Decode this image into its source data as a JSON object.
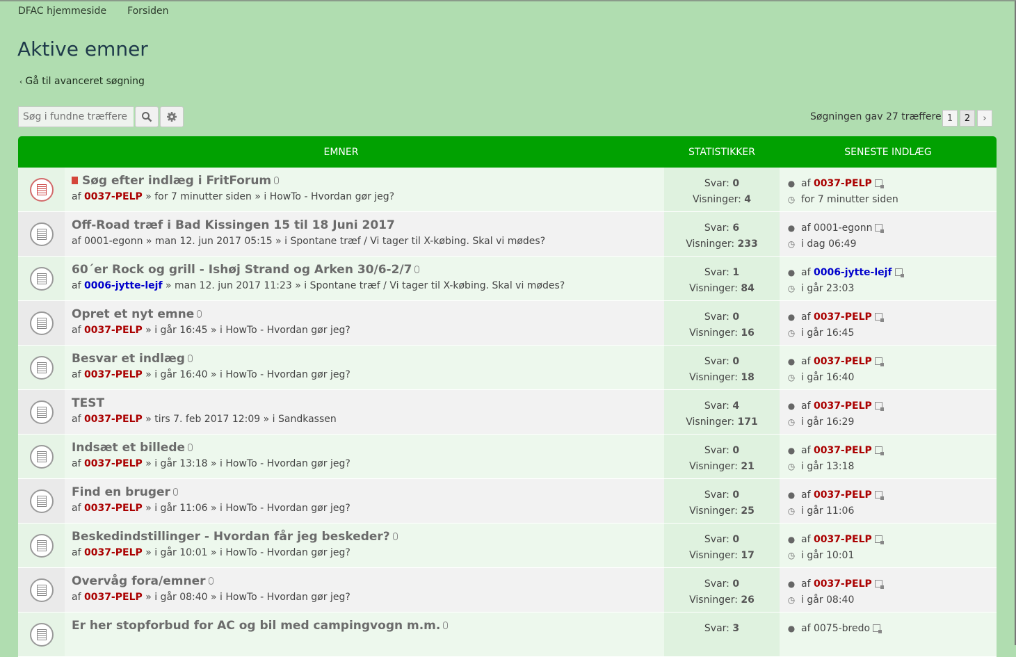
{
  "breadcrumbs": [
    "DFAC hjemmeside",
    "Forsiden"
  ],
  "page_title": "Aktive emner",
  "advanced_search": "Gå til avanceret søgning",
  "search": {
    "placeholder": "Søg i fundne træffere"
  },
  "results_text": "Søgningen gav 27 træffere",
  "pagination": [
    "1",
    "2"
  ],
  "columns": {
    "topics": "EMNER",
    "stats": "STATISTIKKER",
    "last": "SENESTE INDLÆG"
  },
  "labels": {
    "by": "af",
    "replies": "Svar:",
    "views": "Visninger:"
  },
  "colors": {
    "header": "#01a101",
    "page_bg": "#b0ddb0",
    "user_red": "#aa0000",
    "user_blue": "#0000cc"
  },
  "topics": [
    {
      "title": "Søg efter indlæg i FritForum",
      "unread": true,
      "attach": true,
      "author": "0037-PELP",
      "author_color": "#aa0000",
      "meta": " » for 7 minutter siden » i HowTo - Hvordan gør jeg?",
      "replies": "0",
      "views": "4",
      "last_author": "0037-PELP",
      "last_author_color": "#aa0000",
      "last_time": "for 7 minutter siden"
    },
    {
      "title": "Off-Road træf i Bad Kissingen 15 til 18 Juni 2017",
      "unread": false,
      "attach": false,
      "author": "0001-egonn",
      "author_color": "",
      "meta": " » man 12. jun 2017 05:15 » i Spontane træf / Vi tager til X-købing. Skal vi mødes?",
      "replies": "6",
      "views": "233",
      "last_author": "0001-egonn",
      "last_author_color": "",
      "last_time": "i dag 06:49"
    },
    {
      "title": "60´er Rock og grill - Ishøj Strand og Arken 30/6-2/7",
      "unread": false,
      "attach": true,
      "author": "0006-jytte-lejf",
      "author_color": "#0000cc",
      "meta": " » man 12. jun 2017 11:23 » i Spontane træf / Vi tager til X-købing. Skal vi mødes?",
      "replies": "1",
      "views": "84",
      "last_author": "0006-jytte-lejf",
      "last_author_color": "#0000cc",
      "last_time": "i går 23:03"
    },
    {
      "title": "Opret et nyt emne",
      "unread": false,
      "attach": true,
      "author": "0037-PELP",
      "author_color": "#aa0000",
      "meta": " » i går 16:45 » i HowTo - Hvordan gør jeg?",
      "replies": "0",
      "views": "16",
      "last_author": "0037-PELP",
      "last_author_color": "#aa0000",
      "last_time": "i går 16:45"
    },
    {
      "title": "Besvar et indlæg",
      "unread": false,
      "attach": true,
      "author": "0037-PELP",
      "author_color": "#aa0000",
      "meta": " » i går 16:40 » i HowTo - Hvordan gør jeg?",
      "replies": "0",
      "views": "18",
      "last_author": "0037-PELP",
      "last_author_color": "#aa0000",
      "last_time": "i går 16:40"
    },
    {
      "title": "TEST",
      "unread": false,
      "attach": false,
      "author": "0037-PELP",
      "author_color": "#aa0000",
      "meta": " » tirs 7. feb 2017 12:09 » i Sandkassen",
      "replies": "4",
      "views": "171",
      "last_author": "0037-PELP",
      "last_author_color": "#aa0000",
      "last_time": "i går 16:29"
    },
    {
      "title": "Indsæt et billede",
      "unread": false,
      "attach": true,
      "author": "0037-PELP",
      "author_color": "#aa0000",
      "meta": " » i går 13:18 » i HowTo - Hvordan gør jeg?",
      "replies": "0",
      "views": "21",
      "last_author": "0037-PELP",
      "last_author_color": "#aa0000",
      "last_time": "i går 13:18"
    },
    {
      "title": "Find en bruger",
      "unread": false,
      "attach": true,
      "author": "0037-PELP",
      "author_color": "#aa0000",
      "meta": " » i går 11:06 » i HowTo - Hvordan gør jeg?",
      "replies": "0",
      "views": "25",
      "last_author": "0037-PELP",
      "last_author_color": "#aa0000",
      "last_time": "i går 11:06"
    },
    {
      "title": "Beskedindstillinger - Hvordan får jeg beskeder?",
      "unread": false,
      "attach": true,
      "author": "0037-PELP",
      "author_color": "#aa0000",
      "meta": " » i går 10:01 » i HowTo - Hvordan gør jeg?",
      "replies": "0",
      "views": "17",
      "last_author": "0037-PELP",
      "last_author_color": "#aa0000",
      "last_time": "i går 10:01"
    },
    {
      "title": "Overvåg fora/emner",
      "unread": false,
      "attach": true,
      "author": "0037-PELP",
      "author_color": "#aa0000",
      "meta": " » i går 08:40 » i HowTo - Hvordan gør jeg?",
      "replies": "0",
      "views": "26",
      "last_author": "0037-PELP",
      "last_author_color": "#aa0000",
      "last_time": "i går 08:40"
    },
    {
      "title": "Er her stopforbud for AC og bil med campingvogn m.m.",
      "unread": false,
      "attach": true,
      "author": "",
      "author_color": "",
      "meta": "",
      "replies": "3",
      "views": "",
      "last_author": "0075-bredo",
      "last_author_color": "",
      "last_time": ""
    }
  ]
}
